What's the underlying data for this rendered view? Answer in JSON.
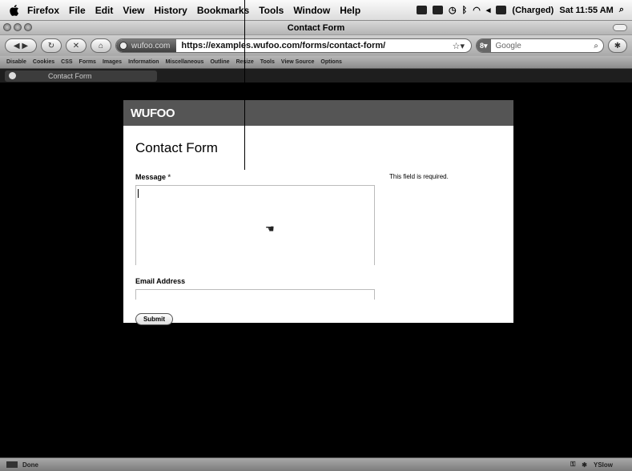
{
  "menubar": {
    "app": "Firefox",
    "items": [
      "File",
      "Edit",
      "View",
      "History",
      "Bookmarks",
      "Tools",
      "Window",
      "Help"
    ],
    "battery": "(Charged)",
    "clock": "Sat 11:55 AM"
  },
  "window": {
    "title": "Contact Form"
  },
  "nav": {
    "identity": "wufoo.com",
    "url": "https://examples.wufoo.com/forms/contact-form/",
    "search_placeholder": "Google"
  },
  "devbar": [
    "Disable",
    "Cookies",
    "CSS",
    "Forms",
    "Images",
    "Information",
    "Miscellaneous",
    "Outline",
    "Resize",
    "Tools",
    "View Source",
    "Options"
  ],
  "tab": {
    "label": "Contact Form"
  },
  "form": {
    "brand": "WUFOO",
    "title": "Contact Form",
    "message_label": "Message",
    "required_mark": "*",
    "error": "This field is required.",
    "email_label": "Email Address",
    "submit": "Submit"
  },
  "status": {
    "text": "Done",
    "yslow": "YSlow"
  }
}
